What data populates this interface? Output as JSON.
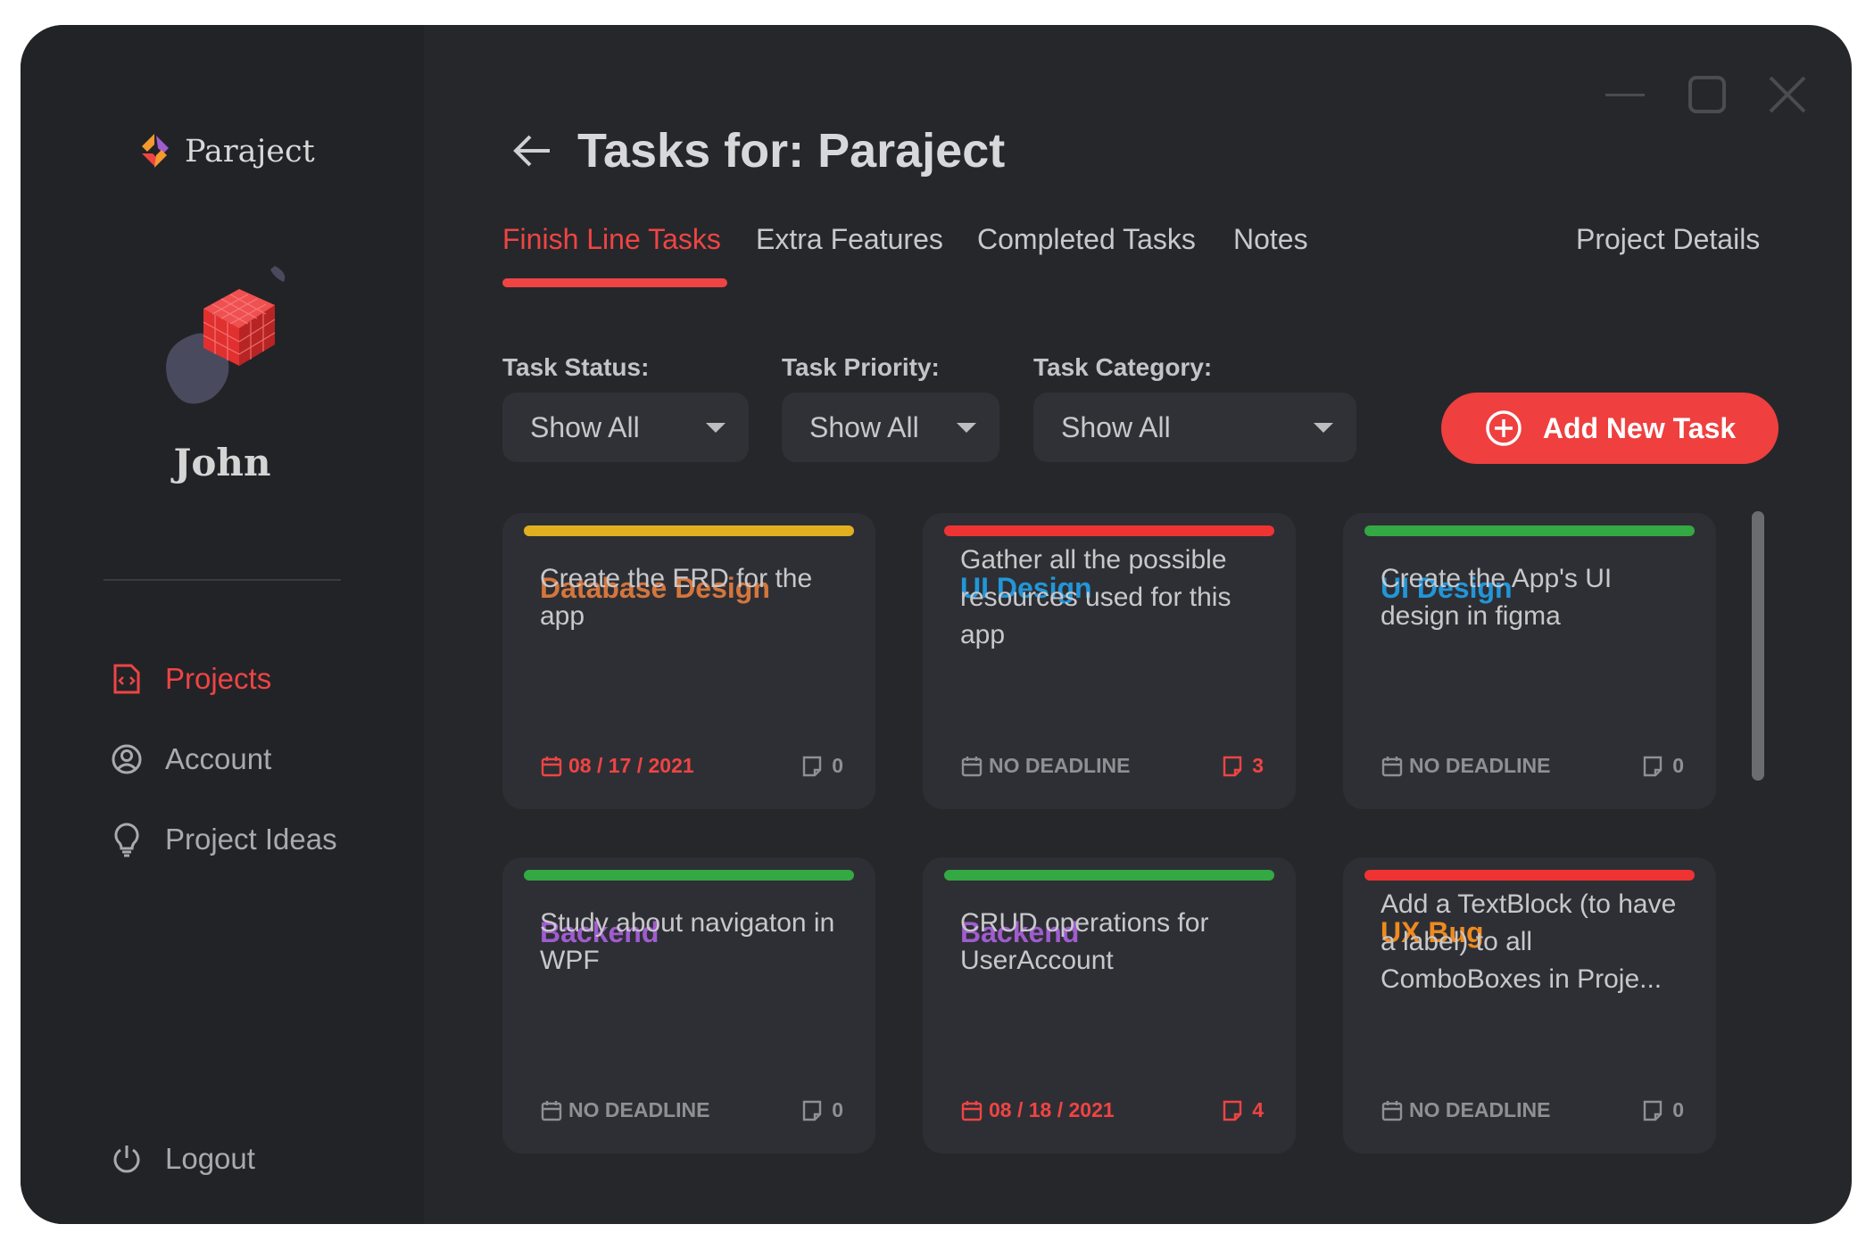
{
  "app": {
    "logo_name": "Paraject"
  },
  "user": {
    "name": "John"
  },
  "sidebar": {
    "items": [
      {
        "label": "Projects",
        "icon": "projects-icon",
        "active": true
      },
      {
        "label": "Account",
        "icon": "account-icon",
        "active": false
      },
      {
        "label": "Project Ideas",
        "icon": "lightbulb-icon",
        "active": false
      }
    ],
    "logout_label": "Logout"
  },
  "header": {
    "title": "Tasks for: Paraject"
  },
  "tabs": [
    {
      "label": "Finish Line Tasks",
      "active": true
    },
    {
      "label": "Extra Features",
      "active": false
    },
    {
      "label": "Completed Tasks",
      "active": false
    },
    {
      "label": "Notes",
      "active": false
    },
    {
      "label": "Project Details",
      "active": false
    }
  ],
  "filters": {
    "status": {
      "label": "Task Status:",
      "value": "Show All"
    },
    "priority": {
      "label": "Task Priority:",
      "value": "Show All"
    },
    "category": {
      "label": "Task Category:",
      "value": "Show All"
    }
  },
  "add_task": {
    "label": "Add New Task"
  },
  "tasks": [
    {
      "category": "Database Design",
      "category_color": "#d4763d",
      "priority_color": "#e0b020",
      "description": "Create the ERD for the app",
      "due": "08 / 17 / 2021",
      "due_color": "#ef4444",
      "notes": "0",
      "notes_color": "#8f9094"
    },
    {
      "category": "UI Design",
      "category_color": "#2196d8",
      "priority_color": "#ef3333",
      "description": "Gather all the possible resources used for this app",
      "due": "NO DEADLINE",
      "due_color": "#8f9094",
      "notes": "3",
      "notes_color": "#ef4444"
    },
    {
      "category": "UI Design",
      "category_color": "#2196d8",
      "priority_color": "#33a843",
      "description": "Create the App's UI design in figma",
      "due": "NO DEADLINE",
      "due_color": "#8f9094",
      "notes": "0",
      "notes_color": "#8f9094"
    },
    {
      "category": "Backend",
      "category_color": "#a05cd0",
      "priority_color": "#33a843",
      "description": "Study about navigaton in WPF",
      "due": "NO DEADLINE",
      "due_color": "#8f9094",
      "notes": "0",
      "notes_color": "#8f9094"
    },
    {
      "category": "Backend",
      "category_color": "#a05cd0",
      "priority_color": "#33a843",
      "description": "CRUD operations for UserAccount",
      "due": "08 / 18 / 2021",
      "due_color": "#ef4444",
      "notes": "4",
      "notes_color": "#ef4444"
    },
    {
      "category": "UX Bug",
      "category_color": "#ef8a1f",
      "priority_color": "#ef3333",
      "description": "Add a TextBlock (to have a label) to all ComboBoxes in Proje...",
      "due": "NO DEADLINE",
      "due_color": "#8f9094",
      "notes": "0",
      "notes_color": "#8f9094"
    }
  ],
  "colors": {
    "window_bg": "#26272b",
    "sidebar_bg": "#222327",
    "card_bg": "#2e2f34",
    "accent": "#ef4444"
  }
}
